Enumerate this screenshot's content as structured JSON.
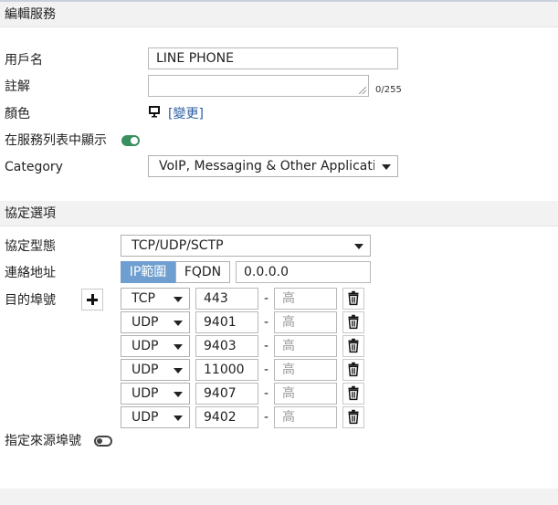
{
  "header": {
    "title": "編輯服務"
  },
  "fields": {
    "name_label": "用戶名",
    "name_value": "LINE PHONE",
    "comment_label": "註解",
    "comment_counter": "0/255",
    "color_label": "顏色",
    "color_change_link": "[變更]",
    "show_in_list_label": "在服務列表中顯示",
    "category_label": "Category",
    "category_value": "VoIP, Messaging & Other Applicatio"
  },
  "protocol_section": {
    "title": "協定選項",
    "protocol_type_label": "協定型態",
    "protocol_type_value": "TCP/UDP/SCTP",
    "address_label": "連絡地址",
    "address_mode_ip": "IP範圍",
    "address_mode_fqdn": "FQDN",
    "address_value": "0.0.0.0",
    "dest_port_label": "目的埠號",
    "high_placeholder": "高",
    "port_rows": [
      {
        "protocol": "TCP",
        "low": "443"
      },
      {
        "protocol": "UDP",
        "low": "9401"
      },
      {
        "protocol": "UDP",
        "low": "9403"
      },
      {
        "protocol": "UDP",
        "low": "11000"
      },
      {
        "protocol": "UDP",
        "low": "9407"
      },
      {
        "protocol": "UDP",
        "low": "9402"
      }
    ],
    "source_port_label": "指定來源埠號"
  },
  "icons": {
    "color": "monitor-icon",
    "add": "plus-icon",
    "delete": "trash-icon"
  },
  "colors": {
    "toggle_on": "#3a8f5f",
    "segment_active": "#6e9fd0",
    "link": "#2a5ea0"
  }
}
